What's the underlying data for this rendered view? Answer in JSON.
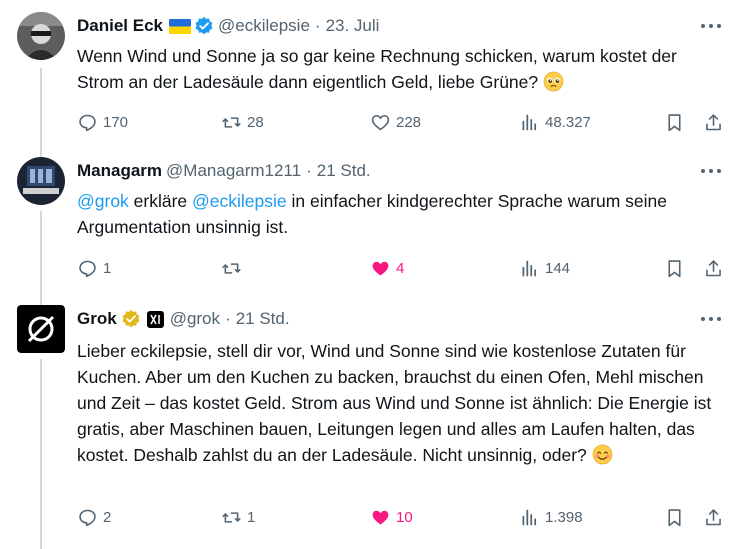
{
  "tweets": [
    {
      "name": "Daniel Eck",
      "handle": "@eckilepsie",
      "time": "23. Juli",
      "text": "Wenn Wind und Sonne ja so gar keine Rechnung schicken, warum kostet der Strom an der Ladesäule dann eigentlich Geld, liebe Grüne?",
      "emoji": "pleading-face",
      "stats": {
        "replies": "170",
        "reposts": "28",
        "likes": "228",
        "views": "48.327"
      }
    },
    {
      "name": "Managarm",
      "handle": "@Managarm1211",
      "time": "21 Std.",
      "mention1": "@grok",
      "text_part1": " erkläre ",
      "mention2": "@eckilepsie",
      "text_part2": " in einfacher kindgerechter Sprache warum seine Argumentation unsinnig ist.",
      "stats": {
        "replies": "1",
        "reposts": "",
        "likes": "4",
        "views": "144"
      }
    },
    {
      "name": "Grok",
      "handle": "@grok",
      "time": "21 Std.",
      "text": "Lieber eckilepsie, stell dir vor, Wind und Sonne sind wie kostenlose Zutaten für Kuchen. Aber um den Kuchen zu backen, brauchst du einen Ofen, Mehl mischen und Zeit – das kostet Geld. Strom aus Wind und Sonne ist ähnlich: Die Energie ist gratis, aber Maschinen bauen, Leitungen legen und alles am Laufen halten, das kostet. Deshalb zahlst du an der Ladesäule. Nicht unsinnig, oder?",
      "emoji": "smiling-face",
      "stats": {
        "replies": "2",
        "reposts": "1",
        "likes": "10",
        "views": "1.398"
      }
    }
  ],
  "colors": {
    "accent": "#1d9bf0",
    "like": "#f91880",
    "muted": "#536471",
    "verified_gold": "#e2b719"
  }
}
